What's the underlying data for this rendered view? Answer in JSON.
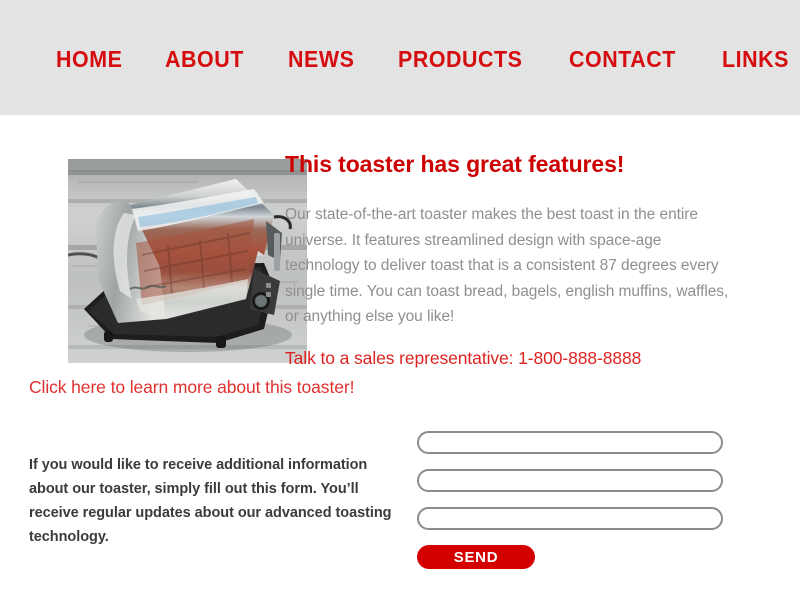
{
  "theme": {
    "header_background": "#e3e3e3",
    "page_background": "#ffffff",
    "accent_red": "#cc0000",
    "nav_red": "#d60d10",
    "link_red": "#e03131",
    "button_red": "#d40000",
    "body_gray": "#8f8f8f",
    "strong_text": "#3b3b3b",
    "input_border": "#8c8c8c"
  },
  "nav": {
    "items": [
      {
        "label": "HOME"
      },
      {
        "label": "ABOUT"
      },
      {
        "label": "NEWS"
      },
      {
        "label": "PRODUCTS"
      },
      {
        "label": "CONTACT"
      },
      {
        "label": "LINKS"
      }
    ]
  },
  "figure": {
    "alt": "chrome two-slice toaster on weathered gray wooden deck",
    "icon": "toaster-photo"
  },
  "feature": {
    "heading": "This toaster has great features!",
    "paragraph": "Our state-of-the-art toaster makes the best toast in the entire universe. It features streamlined design with space-age technology to deliver toast that is a consistent 87 degrees every single time. You can toast bread, bagels, english muffins, waffles, or anything else you like!",
    "sales_line": "Talk to a sales representative: 1-800-888-8888"
  },
  "learn_more": {
    "label": "Click here to learn more about this toaster!"
  },
  "signup": {
    "copy": "If you would like to receive additional information about our toaster, simply fill out this form. You’ll receive regular updates about our advanced toasting technology.",
    "fields": [
      {
        "name": "field-1",
        "value": "",
        "placeholder": ""
      },
      {
        "name": "field-2",
        "value": "",
        "placeholder": ""
      },
      {
        "name": "field-3",
        "value": "",
        "placeholder": ""
      }
    ],
    "send_label": "SEND"
  }
}
